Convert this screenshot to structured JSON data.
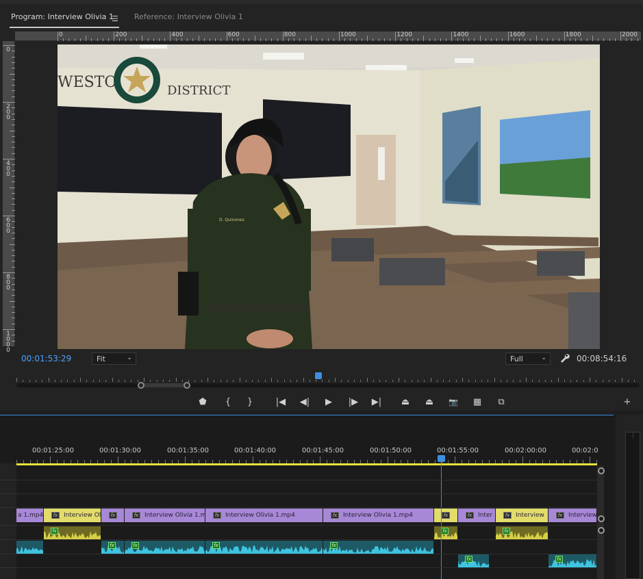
{
  "monitor": {
    "tabs": [
      {
        "label": "Program: Interview Olivia 1",
        "active": true
      },
      {
        "label": "Reference: Interview Olivia 1",
        "active": false
      }
    ],
    "menu_icon": "hamburger-icon",
    "ruler_top_labels": [
      "0",
      "200",
      "400",
      "600",
      "800",
      "1000",
      "1200",
      "1400",
      "1600",
      "1800",
      "2000"
    ],
    "ruler_left_labels": [
      "0",
      "200",
      "400",
      "600",
      "800",
      "1000"
    ],
    "current_timecode": "00:01:53:29",
    "duration_timecode": "00:08:54:16",
    "zoom_select": "Fit",
    "resolution_select": "Full",
    "video": {
      "wall_text_left": "WESTON",
      "wall_text_right": "DISTRICT",
      "seal_text_top": "SHERIFF'S OFFICE",
      "seal_text_bottom": "BROWARD COUNTY",
      "name_tag": "D. Quinones"
    },
    "transport": [
      {
        "name": "add-marker-button",
        "glyph": "⬟"
      },
      {
        "name": "mark-in-button",
        "glyph": "{"
      },
      {
        "name": "mark-out-button",
        "glyph": "}"
      },
      {
        "name": "go-to-in-button",
        "glyph": "|◀"
      },
      {
        "name": "step-back-button",
        "glyph": "◀|"
      },
      {
        "name": "play-button",
        "glyph": "▶"
      },
      {
        "name": "step-forward-button",
        "glyph": "|▶"
      },
      {
        "name": "go-to-out-button",
        "glyph": "▶|"
      },
      {
        "name": "lift-button",
        "glyph": "⏏"
      },
      {
        "name": "extract-button",
        "glyph": "⏏"
      },
      {
        "name": "export-frame-button",
        "glyph": "📷"
      },
      {
        "name": "comparison-view-button",
        "glyph": "▦"
      },
      {
        "name": "proxy-toggle-button",
        "glyph": "⧉"
      },
      {
        "name": "button-editor-button",
        "glyph": "+"
      }
    ]
  },
  "timeline": {
    "time_labels": [
      "00:01:25:00",
      "00:01:30:00",
      "00:01:35:00",
      "00:01:40:00",
      "00:01:45:00",
      "00:01:50:00",
      "00:01:55:00",
      "00:02:00:00",
      "00:02:0"
    ],
    "video_clips": [
      {
        "label": "a 1.mp4",
        "color": "purple",
        "fx": false
      },
      {
        "label": "Interview Oli",
        "color": "yellow",
        "fx": true
      },
      {
        "label": "",
        "color": "purple",
        "fx": true
      },
      {
        "label": "Interview Olivia 1.m",
        "color": "purple",
        "fx": true
      },
      {
        "label": "Interview Olivia 1.mp4",
        "color": "purple",
        "fx": true
      },
      {
        "label": "Interview Olivia 1.mp4",
        "color": "purple",
        "fx": true
      },
      {
        "label": "",
        "color": "yellow",
        "fx": true
      },
      {
        "label": "Inter",
        "color": "purple",
        "fx": true
      },
      {
        "label": "Interview",
        "color": "yellow",
        "fx": true
      },
      {
        "label": "Interview",
        "color": "purple",
        "fx": true
      }
    ],
    "colors": {
      "purple": "#a688d6",
      "yellow": "#e2dc6a",
      "audio_teal": "#1e5a66",
      "audio_yellow": "#6e6a23",
      "playhead": "#3d8fe0"
    }
  }
}
